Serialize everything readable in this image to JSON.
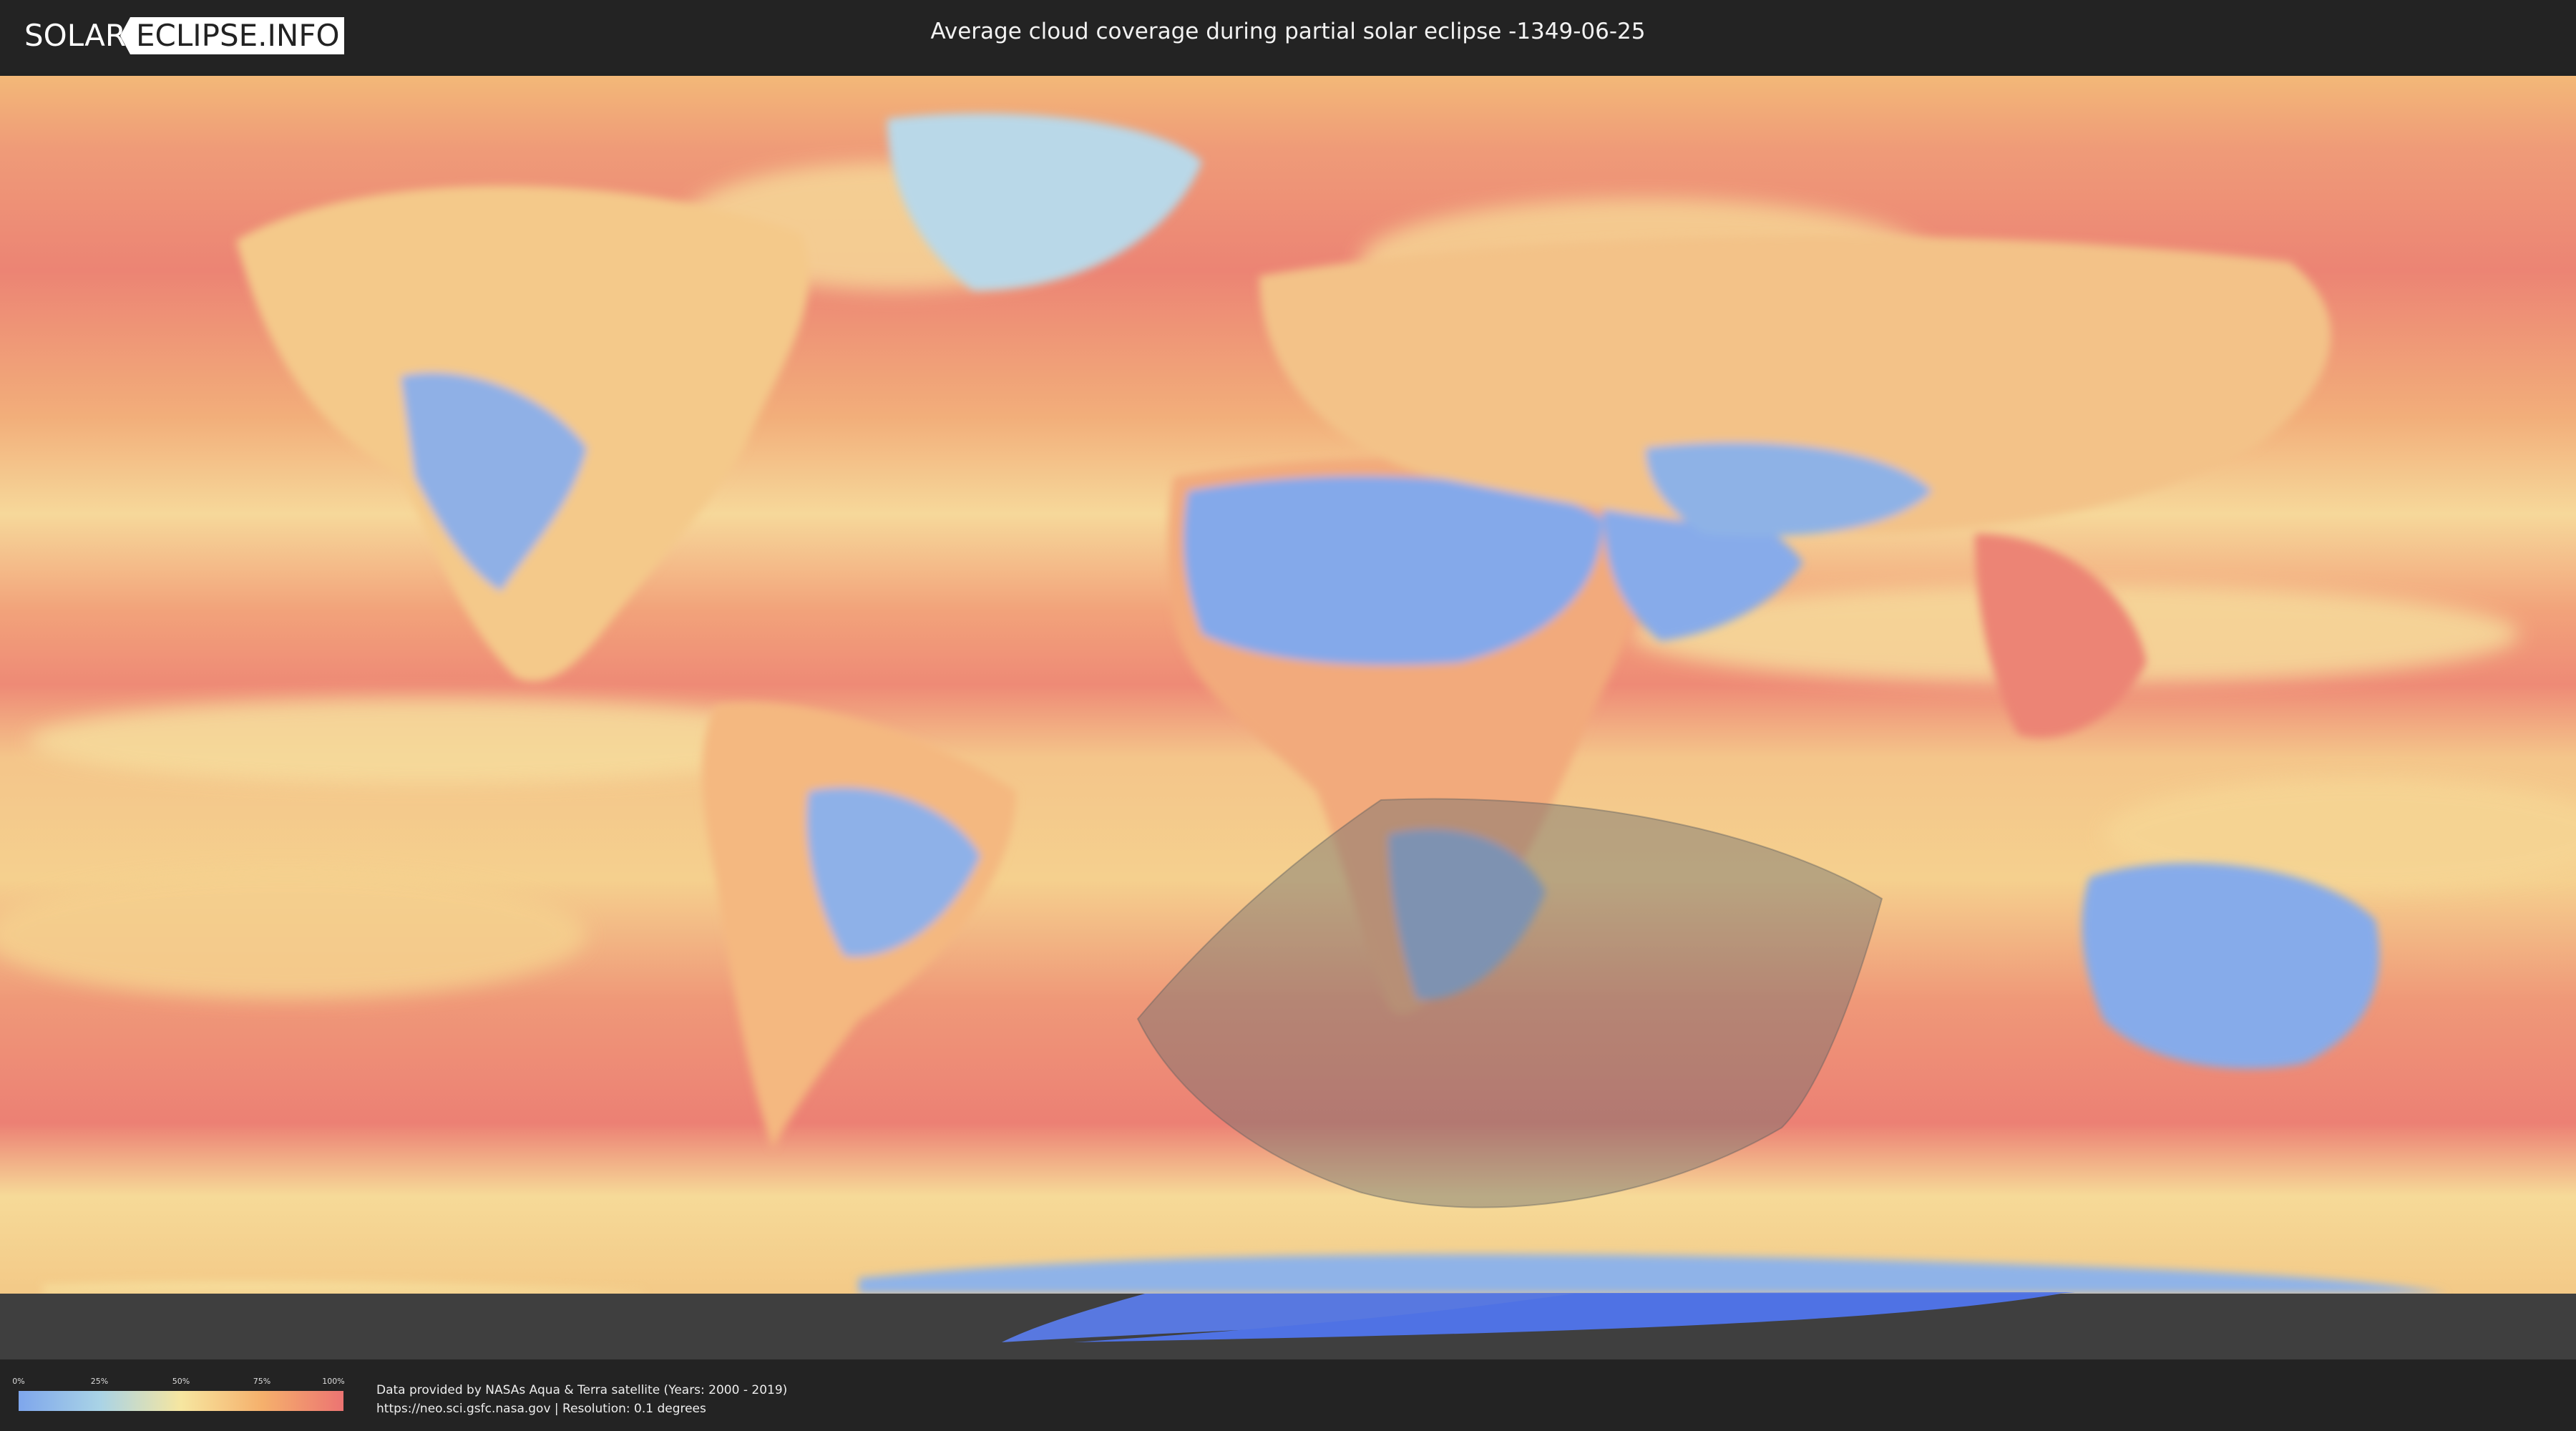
{
  "header": {
    "logo_left": "SOLAR",
    "logo_right": "ECLIPSE.INFO",
    "title": "Average cloud coverage during partial solar eclipse -1349-06-25"
  },
  "legend": {
    "ticks": [
      "0%",
      "25%",
      "50%",
      "75%",
      "100%"
    ],
    "colors": [
      "#7ea6ec",
      "#a9d3e6",
      "#f6e6a0",
      "#f5b06c",
      "#ec7472"
    ]
  },
  "credits": {
    "line1": "Data provided by NASAs Aqua & Terra satellite (Years: 2000 - 2019)",
    "line2": "https://neo.sci.gsfc.nasa.gov | Resolution: 0.1 degrees"
  },
  "map": {
    "ocean_color": "#ee8a74",
    "dry_color": "#84a9ea",
    "moderate_color": "#f5d995",
    "eclipse_overlay_color": "#6f6f6f"
  }
}
